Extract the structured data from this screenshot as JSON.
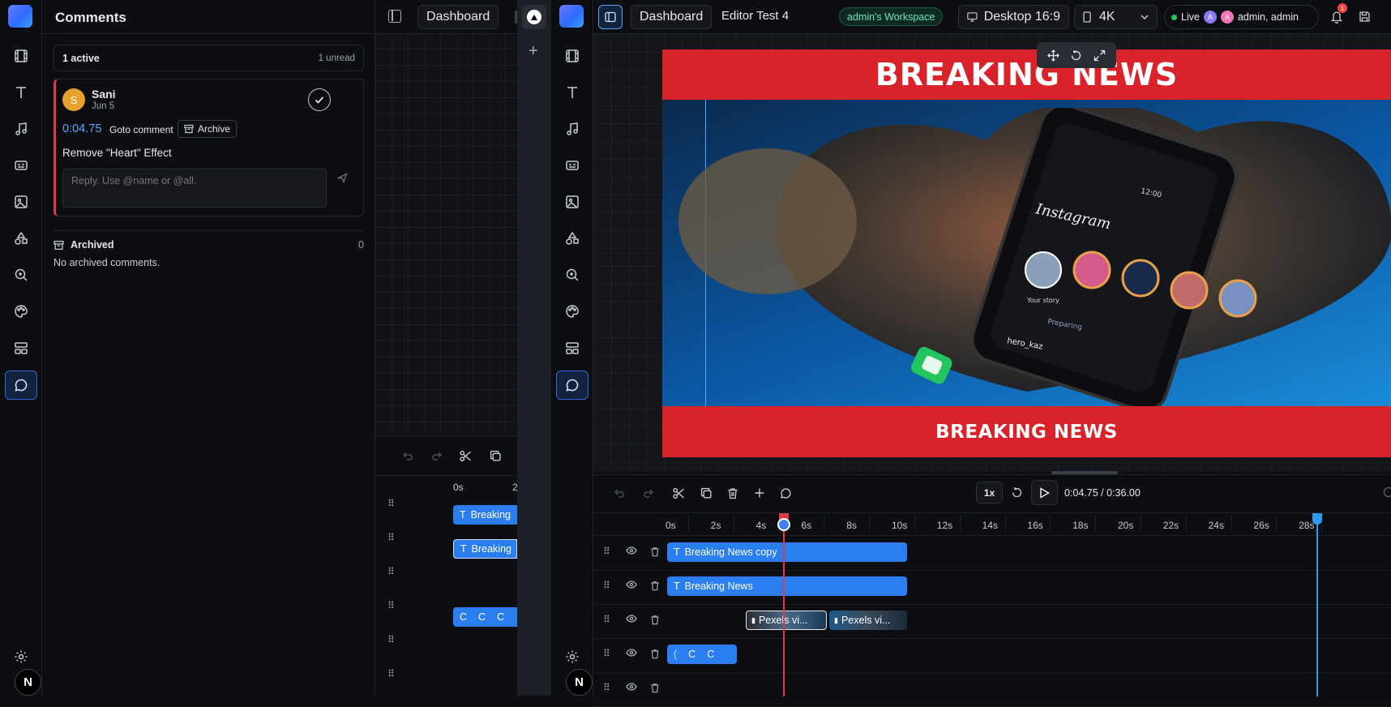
{
  "left_rail": {
    "items": [
      "film",
      "text",
      "music",
      "caption",
      "image",
      "shapes",
      "zoom",
      "palette",
      "layout",
      "comments"
    ],
    "settings": "gear",
    "avatar": "N"
  },
  "comments": {
    "title": "Comments",
    "active_label": "1 active",
    "unread_label": "1 unread",
    "comment": {
      "avatar": "S",
      "author": "Sani",
      "date": "Jun 5",
      "time": "0:04.75",
      "goto": "Goto comment",
      "archive": "Archive",
      "text": "Remove \"Heart\" Effect",
      "reply_placeholder": "Reply. Use @name or @all."
    },
    "archived": {
      "label": "Archived",
      "count": "0",
      "empty": "No archived comments."
    }
  },
  "mid_panel": {
    "dashboard": "Dashboard",
    "ruler": [
      "0s",
      "2"
    ],
    "clips": [
      "Breaking",
      "Breaking",
      "C",
      "C",
      "C"
    ]
  },
  "topbar": {
    "dashboard": "Dashboard",
    "project": "Editor Test 4",
    "workspace": "admin's Workspace",
    "device": "Desktop 16:9",
    "resolution": "4K",
    "live": "Live",
    "users": "admin, admin",
    "notifications": "1",
    "avatars": [
      "A",
      "A"
    ]
  },
  "canvas": {
    "headline_top": "BREAKING NEWS",
    "headline_bottom": "BREAKING NEWS",
    "phone_app": "Instagram",
    "handle": "hero_kaz",
    "preparing": "Preparing",
    "time": "12:00",
    "your_story": "Your story"
  },
  "timeline": {
    "speed": "1x",
    "time_display": "0:04.75 / 0:36.00",
    "ruler": [
      "0s",
      "2s",
      "4s",
      "6s",
      "8s",
      "10s",
      "12s",
      "14s",
      "16s",
      "18s",
      "20s",
      "22s",
      "24s",
      "26s",
      "28s"
    ],
    "tracks": [
      {
        "label": "Breaking News copy"
      },
      {
        "label": "Breaking News"
      },
      {
        "clips": [
          "Pexels vi...",
          "Pexels vi..."
        ]
      },
      {
        "clips": [
          "C",
          "C",
          "C"
        ]
      }
    ]
  },
  "colors": {
    "accent": "#2b7ef0",
    "red": "#d9222a",
    "live": "#22c55e",
    "playhead": "#e03a4a"
  }
}
